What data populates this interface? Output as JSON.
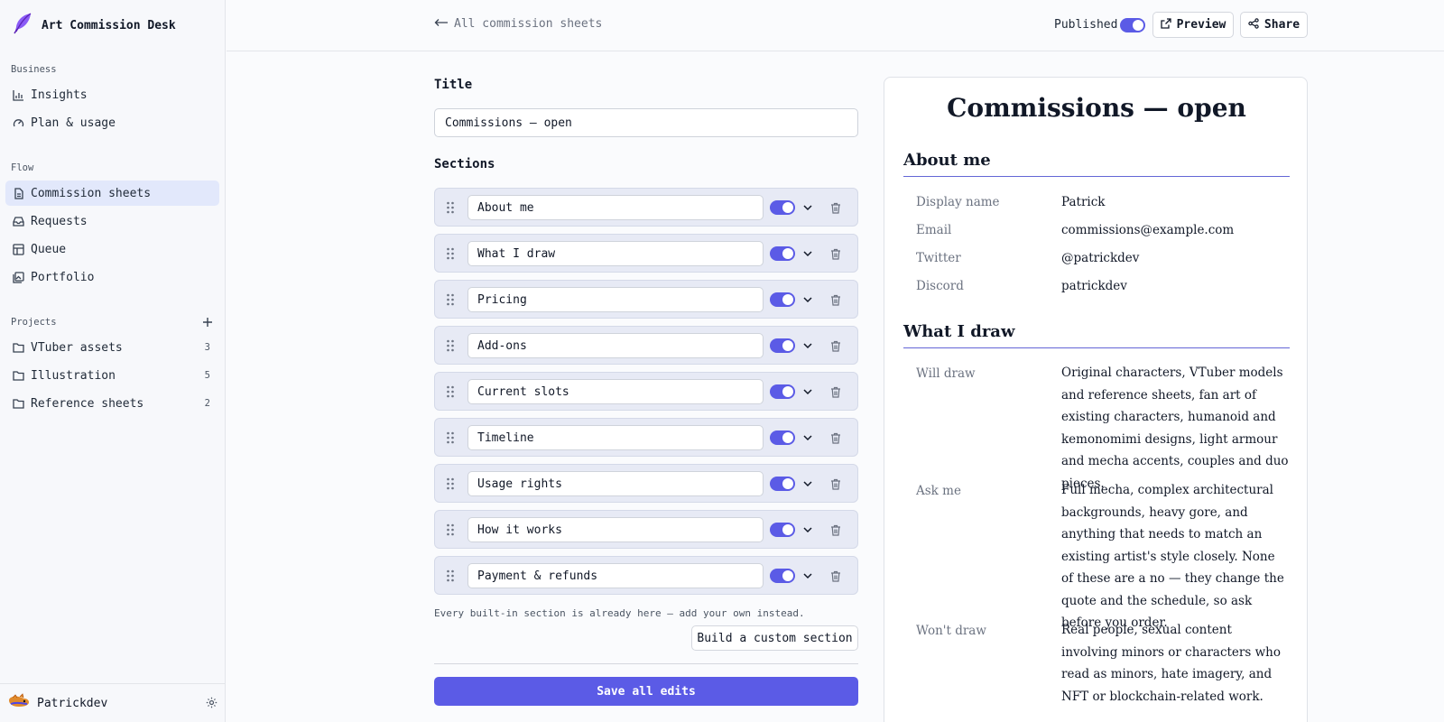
{
  "app": {
    "name": "Art Commission Desk"
  },
  "sidebar": {
    "business_label": "Business",
    "business": [
      {
        "label": "Insights",
        "icon": "bar-chart-icon"
      },
      {
        "label": "Plan & usage",
        "icon": "gauge-icon"
      }
    ],
    "flow_label": "Flow",
    "flow": [
      {
        "label": "Commission sheets",
        "icon": "document-icon",
        "active": true
      },
      {
        "label": "Requests",
        "icon": "inbox-icon"
      },
      {
        "label": "Queue",
        "icon": "table-icon"
      },
      {
        "label": "Portfolio",
        "icon": "gallery-icon"
      }
    ],
    "projects_label": "Projects",
    "projects": [
      {
        "label": "VTuber assets",
        "count": "3"
      },
      {
        "label": "Illustration",
        "count": "5"
      },
      {
        "label": "Reference sheets",
        "count": "2"
      }
    ],
    "user": "Patrickdev"
  },
  "topbar": {
    "back": "All commission sheets",
    "published_label": "Published",
    "published": true,
    "preview": "Preview",
    "share": "Share"
  },
  "editor": {
    "title_label": "Title",
    "title_value": "Commissions — open",
    "sections_label": "Sections",
    "sections": [
      "About me",
      "What I draw",
      "Pricing",
      "Add-ons",
      "Current slots",
      "Timeline",
      "Usage rights",
      "How it works",
      "Payment & refunds"
    ],
    "hint": "Every built-in section is already here — add your own instead.",
    "custom_button": "Build a custom section",
    "save_button": "Save all edits"
  },
  "preview": {
    "title": "Commissions — open",
    "about_heading": "About me",
    "about": [
      {
        "key": "Display name",
        "value": "Patrick"
      },
      {
        "key": "Email",
        "value": "commissions@example.com"
      },
      {
        "key": "Twitter",
        "value": "@patrickdev"
      },
      {
        "key": "Discord",
        "value": "patrickdev"
      }
    ],
    "draw_heading": "What I draw",
    "draw": [
      {
        "key": "Will draw",
        "value": "Original characters, VTuber models and reference sheets, fan art of existing characters, humanoid and kemonomimi designs, light armour and mecha accents, couples and duo pieces."
      },
      {
        "key": "Ask me",
        "value": "Full mecha, complex architectural backgrounds, heavy gore, and anything that needs to match an existing artist's style closely. None of these are a no — they change the quote and the schedule, so ask before you order."
      },
      {
        "key": "Won't draw",
        "value": "Real people, sexual content involving minors or characters who read as minors, hate imagery, and NFT or blockchain-related work."
      }
    ]
  },
  "colors": {
    "accent": "#5b5be6",
    "active_nav": "#e2e8fb",
    "section_bg": "#e7eaf5"
  }
}
